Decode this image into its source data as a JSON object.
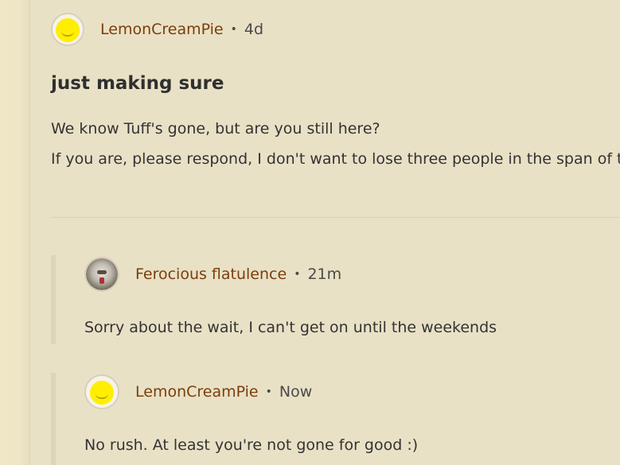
{
  "post": {
    "author": "LemonCreamPie",
    "time": "4d",
    "title": "just making sure",
    "body": [
      "We know Tuff's gone, but are you still here?",
      "If you are, please respond, I don't want to lose three people in the span of t"
    ],
    "avatar_icon": "yellow-smiley-avatar"
  },
  "separator": "•",
  "replies": [
    {
      "author": "Ferocious flatulence",
      "time": "21m",
      "text": "Sorry about the wait, I can't get on until the weekends",
      "avatar_icon": "clown-avatar"
    },
    {
      "author": "LemonCreamPie",
      "time": "Now",
      "text": "No rush. At least you're not gone for good :)",
      "avatar_icon": "yellow-smiley-avatar"
    }
  ],
  "colors": {
    "background": "#e9e1c6",
    "username": "#7a3e0b",
    "text": "#333333",
    "avatar_yellow": "#ffee00"
  }
}
